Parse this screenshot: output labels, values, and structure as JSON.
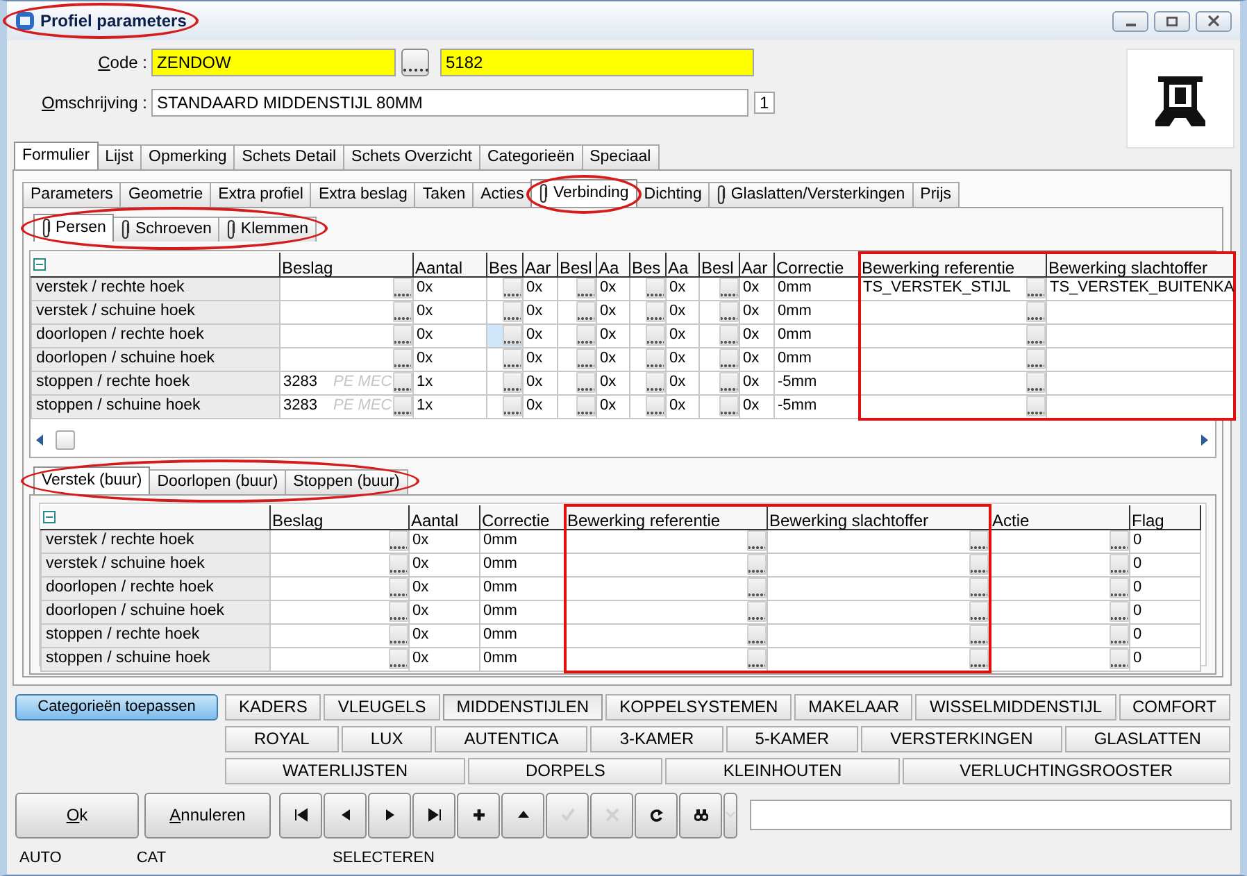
{
  "window": {
    "title": "Profiel parameters",
    "circled": true
  },
  "code": {
    "label": "Code :",
    "value": "ZENDOW",
    "number": "5182"
  },
  "description": {
    "label": "Omschrijving :",
    "value": "STANDAARD MIDDENSTIJL 80MM",
    "count": "1"
  },
  "main_tabs": [
    {
      "label": "Formulier",
      "selected": true
    },
    {
      "label": "Lijst",
      "selected": false
    },
    {
      "label": "Opmerking",
      "selected": false
    },
    {
      "label": "Schets Detail",
      "selected": false
    },
    {
      "label": "Schets Overzicht",
      "selected": false
    },
    {
      "label": "Categorieën",
      "selected": false
    },
    {
      "label": "Speciaal",
      "selected": false
    }
  ],
  "sub_tabs": [
    {
      "label": "Parameters",
      "selected": false,
      "attachment": false,
      "circled": false
    },
    {
      "label": "Geometrie",
      "selected": false,
      "attachment": false,
      "circled": false
    },
    {
      "label": "Extra profiel",
      "selected": false,
      "attachment": false,
      "circled": false
    },
    {
      "label": "Extra beslag",
      "selected": false,
      "attachment": false,
      "circled": false
    },
    {
      "label": "Taken",
      "selected": false,
      "attachment": false,
      "circled": false
    },
    {
      "label": "Acties",
      "selected": false,
      "attachment": false,
      "circled": false
    },
    {
      "label": "Verbinding",
      "selected": true,
      "attachment": true,
      "circled": true
    },
    {
      "label": "Dichting",
      "selected": false,
      "attachment": false,
      "circled": false
    },
    {
      "label": "Glaslatten/Versterkingen",
      "selected": false,
      "attachment": true,
      "circled": false
    },
    {
      "label": "Prijs",
      "selected": false,
      "attachment": false,
      "circled": false
    }
  ],
  "connection_tabs": {
    "circled": true,
    "items": [
      {
        "label": "Persen",
        "selected": true,
        "attachment": true
      },
      {
        "label": "Schroeven",
        "selected": false,
        "attachment": true
      },
      {
        "label": "Klemmen",
        "selected": false,
        "attachment": true
      }
    ]
  },
  "connection_grid": {
    "columns": [
      {
        "label": "Beslag",
        "picker": true,
        "outlined": false
      },
      {
        "label": "Aantal",
        "picker": false,
        "outlined": false
      },
      {
        "label": "Bes",
        "picker": true,
        "outlined": false
      },
      {
        "label": "Aar",
        "picker": false,
        "outlined": false
      },
      {
        "label": "Besl",
        "picker": true,
        "outlined": false
      },
      {
        "label": "Aa",
        "picker": false,
        "outlined": false
      },
      {
        "label": "Bes",
        "picker": true,
        "outlined": false
      },
      {
        "label": "Aa",
        "picker": false,
        "outlined": false
      },
      {
        "label": "Besl",
        "picker": true,
        "outlined": false
      },
      {
        "label": "Aar",
        "picker": false,
        "outlined": false
      },
      {
        "label": "Correctie",
        "picker": false,
        "outlined": false
      },
      {
        "label": "Bewerking referentie",
        "picker": true,
        "outlined": true
      },
      {
        "label": "Bewerking slachtoffer",
        "picker": false,
        "outlined": true
      }
    ],
    "rows": [
      {
        "label": "verstek / rechte hoek",
        "cells": [
          {},
          {
            "text": "0x"
          },
          {},
          {
            "text": "0x"
          },
          {},
          {
            "text": "0x"
          },
          {},
          {
            "text": "0x"
          },
          {},
          {
            "text": "0x"
          },
          {
            "text": "0mm"
          },
          {
            "text": "TS_VERSTEK_STIJL"
          },
          {
            "text": "TS_VERSTEK_BUITENKA"
          }
        ]
      },
      {
        "label": "verstek / schuine hoek",
        "cells": [
          {},
          {
            "text": "0x"
          },
          {},
          {
            "text": "0x"
          },
          {},
          {
            "text": "0x"
          },
          {},
          {
            "text": "0x"
          },
          {},
          {
            "text": "0x"
          },
          {
            "text": "0mm"
          },
          {},
          {}
        ]
      },
      {
        "label": "doorlopen / rechte hoek",
        "cells": [
          {},
          {
            "text": "0x"
          },
          {
            "focused": true
          },
          {
            "text": "0x"
          },
          {},
          {
            "text": "0x"
          },
          {},
          {
            "text": "0x"
          },
          {},
          {
            "text": "0x"
          },
          {
            "text": "0mm"
          },
          {},
          {}
        ]
      },
      {
        "label": "doorlopen / schuine hoek",
        "cells": [
          {},
          {
            "text": "0x"
          },
          {},
          {
            "text": "0x"
          },
          {},
          {
            "text": "0x"
          },
          {},
          {
            "text": "0x"
          },
          {},
          {
            "text": "0x"
          },
          {
            "text": "0mm"
          },
          {},
          {}
        ]
      },
      {
        "label": "stoppen / rechte hoek",
        "cells": [
          {
            "text": "3283",
            "hint": "PE MEC"
          },
          {
            "text": "1x"
          },
          {},
          {
            "text": "0x"
          },
          {},
          {
            "text": "0x"
          },
          {},
          {
            "text": "0x"
          },
          {},
          {
            "text": "0x"
          },
          {
            "text": "-5mm"
          },
          {},
          {}
        ]
      },
      {
        "label": "stoppen / schuine hoek",
        "cells": [
          {
            "text": "3283",
            "hint": "PE MEC"
          },
          {
            "text": "1x"
          },
          {},
          {
            "text": "0x"
          },
          {},
          {
            "text": "0x"
          },
          {},
          {
            "text": "0x"
          },
          {},
          {
            "text": "0x"
          },
          {
            "text": "-5mm"
          },
          {},
          {}
        ]
      }
    ]
  },
  "neighbour_tabs": {
    "circled": true,
    "items": [
      {
        "label": "Verstek (buur)",
        "selected": true
      },
      {
        "label": "Doorlopen (buur)",
        "selected": false
      },
      {
        "label": "Stoppen (buur)",
        "selected": false
      }
    ]
  },
  "neighbour_grid": {
    "columns": [
      {
        "label": "Beslag",
        "picker": true,
        "outlined": false
      },
      {
        "label": "Aantal",
        "picker": false,
        "outlined": false
      },
      {
        "label": "Correctie",
        "picker": false,
        "outlined": false
      },
      {
        "label": "Bewerking referentie",
        "picker": true,
        "outlined": true
      },
      {
        "label": "Bewerking slachtoffer",
        "picker": true,
        "outlined": true
      },
      {
        "label": "Actie",
        "picker": true,
        "outlined": false
      },
      {
        "label": "Flag",
        "picker": false,
        "outlined": false
      }
    ],
    "rows": [
      {
        "label": "verstek / rechte hoek",
        "cells": [
          {},
          {
            "text": "0x"
          },
          {
            "text": "0mm"
          },
          {},
          {},
          {},
          {
            "text": "0"
          }
        ]
      },
      {
        "label": "verstek / schuine hoek",
        "cells": [
          {},
          {
            "text": "0x"
          },
          {
            "text": "0mm"
          },
          {},
          {},
          {},
          {
            "text": "0"
          }
        ]
      },
      {
        "label": "doorlopen / rechte hoek",
        "cells": [
          {},
          {
            "text": "0x"
          },
          {
            "text": "0mm"
          },
          {},
          {},
          {},
          {
            "text": "0"
          }
        ]
      },
      {
        "label": "doorlopen / schuine hoek",
        "cells": [
          {},
          {
            "text": "0x"
          },
          {
            "text": "0mm"
          },
          {},
          {},
          {},
          {
            "text": "0"
          }
        ]
      },
      {
        "label": "stoppen / rechte hoek",
        "cells": [
          {},
          {
            "text": "0x"
          },
          {
            "text": "0mm"
          },
          {},
          {},
          {},
          {
            "text": "0"
          }
        ]
      },
      {
        "label": "stoppen / schuine hoek",
        "cells": [
          {},
          {
            "text": "0x"
          },
          {
            "text": "0mm"
          },
          {},
          {},
          {},
          {
            "text": "0"
          }
        ]
      }
    ]
  },
  "apply_button": "Categorieën toepassen",
  "categories": [
    [
      {
        "label": "KADERS",
        "selected": false
      },
      {
        "label": "VLEUGELS",
        "selected": false
      },
      {
        "label": "MIDDENSTIJLEN",
        "selected": true
      },
      {
        "label": "KOPPELSYSTEMEN",
        "selected": false
      },
      {
        "label": "MAKELAAR",
        "selected": false
      },
      {
        "label": "WISSELMIDDENSTIJL",
        "selected": false
      },
      {
        "label": "COMFORT",
        "selected": false
      }
    ],
    [
      {
        "label": "ROYAL",
        "selected": false
      },
      {
        "label": "LUX",
        "selected": false
      },
      {
        "label": "AUTENTICA",
        "selected": false
      },
      {
        "label": "3-KAMER",
        "selected": false
      },
      {
        "label": "5-KAMER",
        "selected": false
      },
      {
        "label": "VERSTERKINGEN",
        "selected": false
      },
      {
        "label": "GLASLATTEN",
        "selected": false
      }
    ],
    [
      {
        "label": "WATERLIJSTEN",
        "selected": false
      },
      {
        "label": "DORPELS",
        "selected": false
      },
      {
        "label": "KLEINHOUTEN",
        "selected": false
      },
      {
        "label": "VERLUCHTINGSROOSTER",
        "selected": false
      }
    ]
  ],
  "buttons": {
    "ok": "Ok",
    "cancel": "Annuleren"
  },
  "toolbar": [
    {
      "kind": "first",
      "disabled": false
    },
    {
      "kind": "previous",
      "disabled": false
    },
    {
      "kind": "next",
      "disabled": false
    },
    {
      "kind": "last",
      "disabled": false
    },
    {
      "kind": "add",
      "disabled": false
    },
    {
      "kind": "up",
      "disabled": false
    },
    {
      "kind": "confirm",
      "disabled": true
    },
    {
      "kind": "cancel",
      "disabled": true
    },
    {
      "kind": "refresh",
      "disabled": false
    },
    {
      "kind": "find",
      "disabled": false
    },
    {
      "kind": "dropdown",
      "disabled": true
    }
  ],
  "status_bar": [
    "AUTO",
    "CAT",
    "SELECTEREN"
  ]
}
